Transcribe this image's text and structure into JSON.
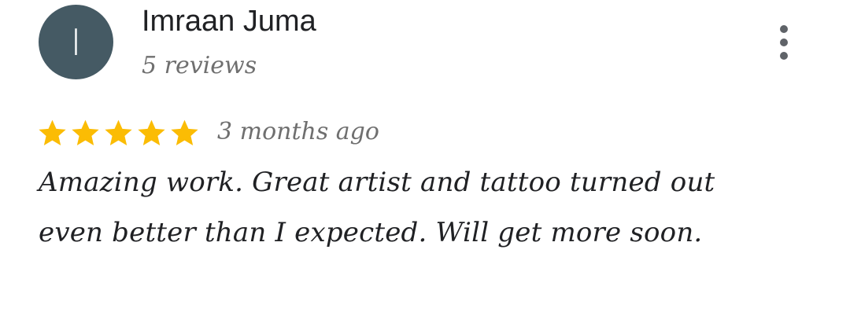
{
  "reviewer": {
    "avatar_initial": "I",
    "avatar_color": "#455a64",
    "name": "Imraan Juma",
    "review_count": "5 reviews"
  },
  "menu": {
    "icon": "more-vert-icon"
  },
  "review": {
    "rating": 5,
    "max_rating": 5,
    "star_color": "#fbbc04",
    "date": "3 months ago",
    "text": "Amazing work. Great artist and tattoo turned out even better than I expected. Will get more soon."
  }
}
